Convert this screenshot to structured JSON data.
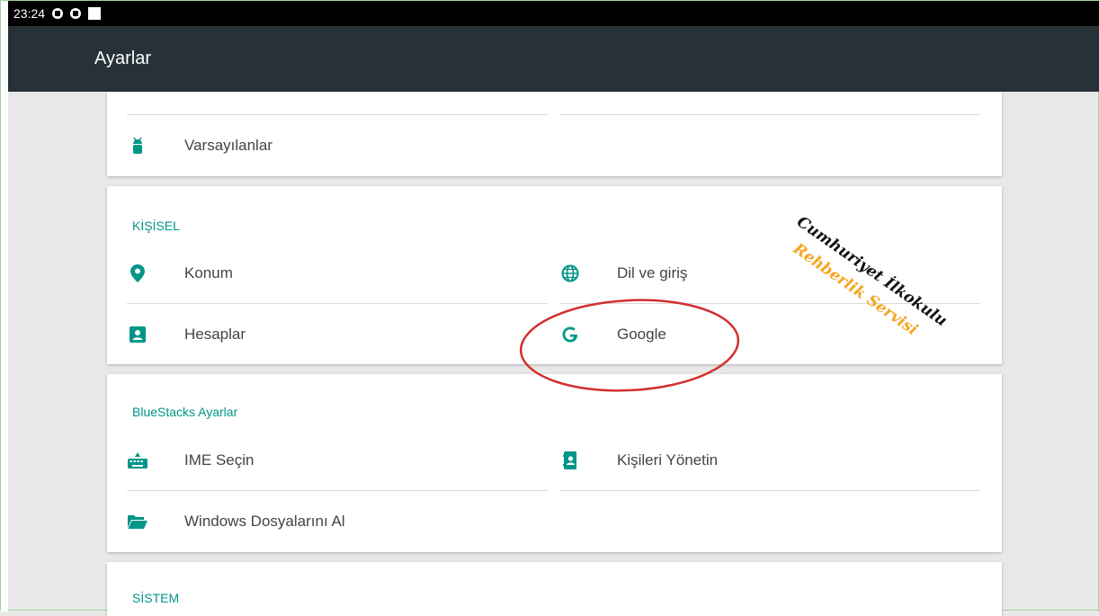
{
  "status_bar": {
    "time": "23:24"
  },
  "app_bar": {
    "title": "Ayarlar"
  },
  "cards": {
    "top": {
      "item_varsayilanlar": "Varsayılanlar"
    },
    "kisisel": {
      "title": "KİŞİSEL",
      "items": [
        "Konum",
        "Dil ve giriş",
        "Hesaplar",
        "Google"
      ]
    },
    "bluestacks": {
      "title": "BlueStacks Ayarlar",
      "items": [
        "IME Seçin",
        "Kişileri Yönetin",
        "Windows Dosyalarını Al"
      ]
    },
    "sistem": {
      "title": "SİSTEM"
    }
  },
  "watermark": {
    "line1": "Cumhuriyet İlkokulu",
    "line2": "Rehberlik Servisi"
  },
  "colors": {
    "accent": "#009688",
    "appbar": "#263238",
    "statusbar": "#000000",
    "annotation": "#d32f2f"
  }
}
